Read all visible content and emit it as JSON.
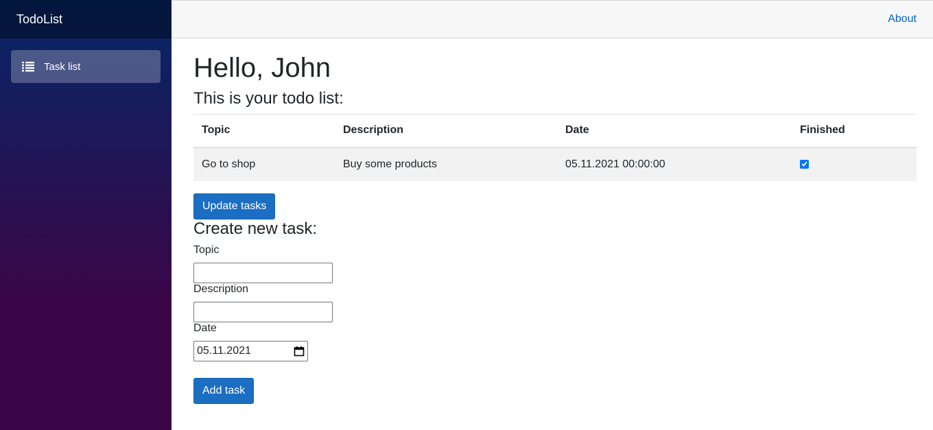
{
  "sidebar": {
    "brand": "TodoList",
    "items": [
      {
        "label": "Task list",
        "icon": "list-icon"
      }
    ]
  },
  "topbar": {
    "about": "About"
  },
  "page": {
    "greeting": "Hello, John",
    "subtitle": "This is your todo list:"
  },
  "table": {
    "headers": [
      "Topic",
      "Description",
      "Date",
      "Finished"
    ],
    "rows": [
      {
        "topic": "Go to shop",
        "description": "Buy some products",
        "date": "05.11.2021 00:00:00",
        "finished": true
      }
    ]
  },
  "actions": {
    "update": "Update tasks"
  },
  "form": {
    "title": "Create new task:",
    "topic_label": "Topic",
    "topic_value": "",
    "description_label": "Description",
    "description_value": "",
    "date_label": "Date",
    "date_value": "05.11.2021",
    "submit": "Add task"
  },
  "colors": {
    "accent": "#1b6ec2",
    "link": "#0366d6",
    "sidebar_top": "#052767",
    "sidebar_bottom": "#3a0647"
  }
}
